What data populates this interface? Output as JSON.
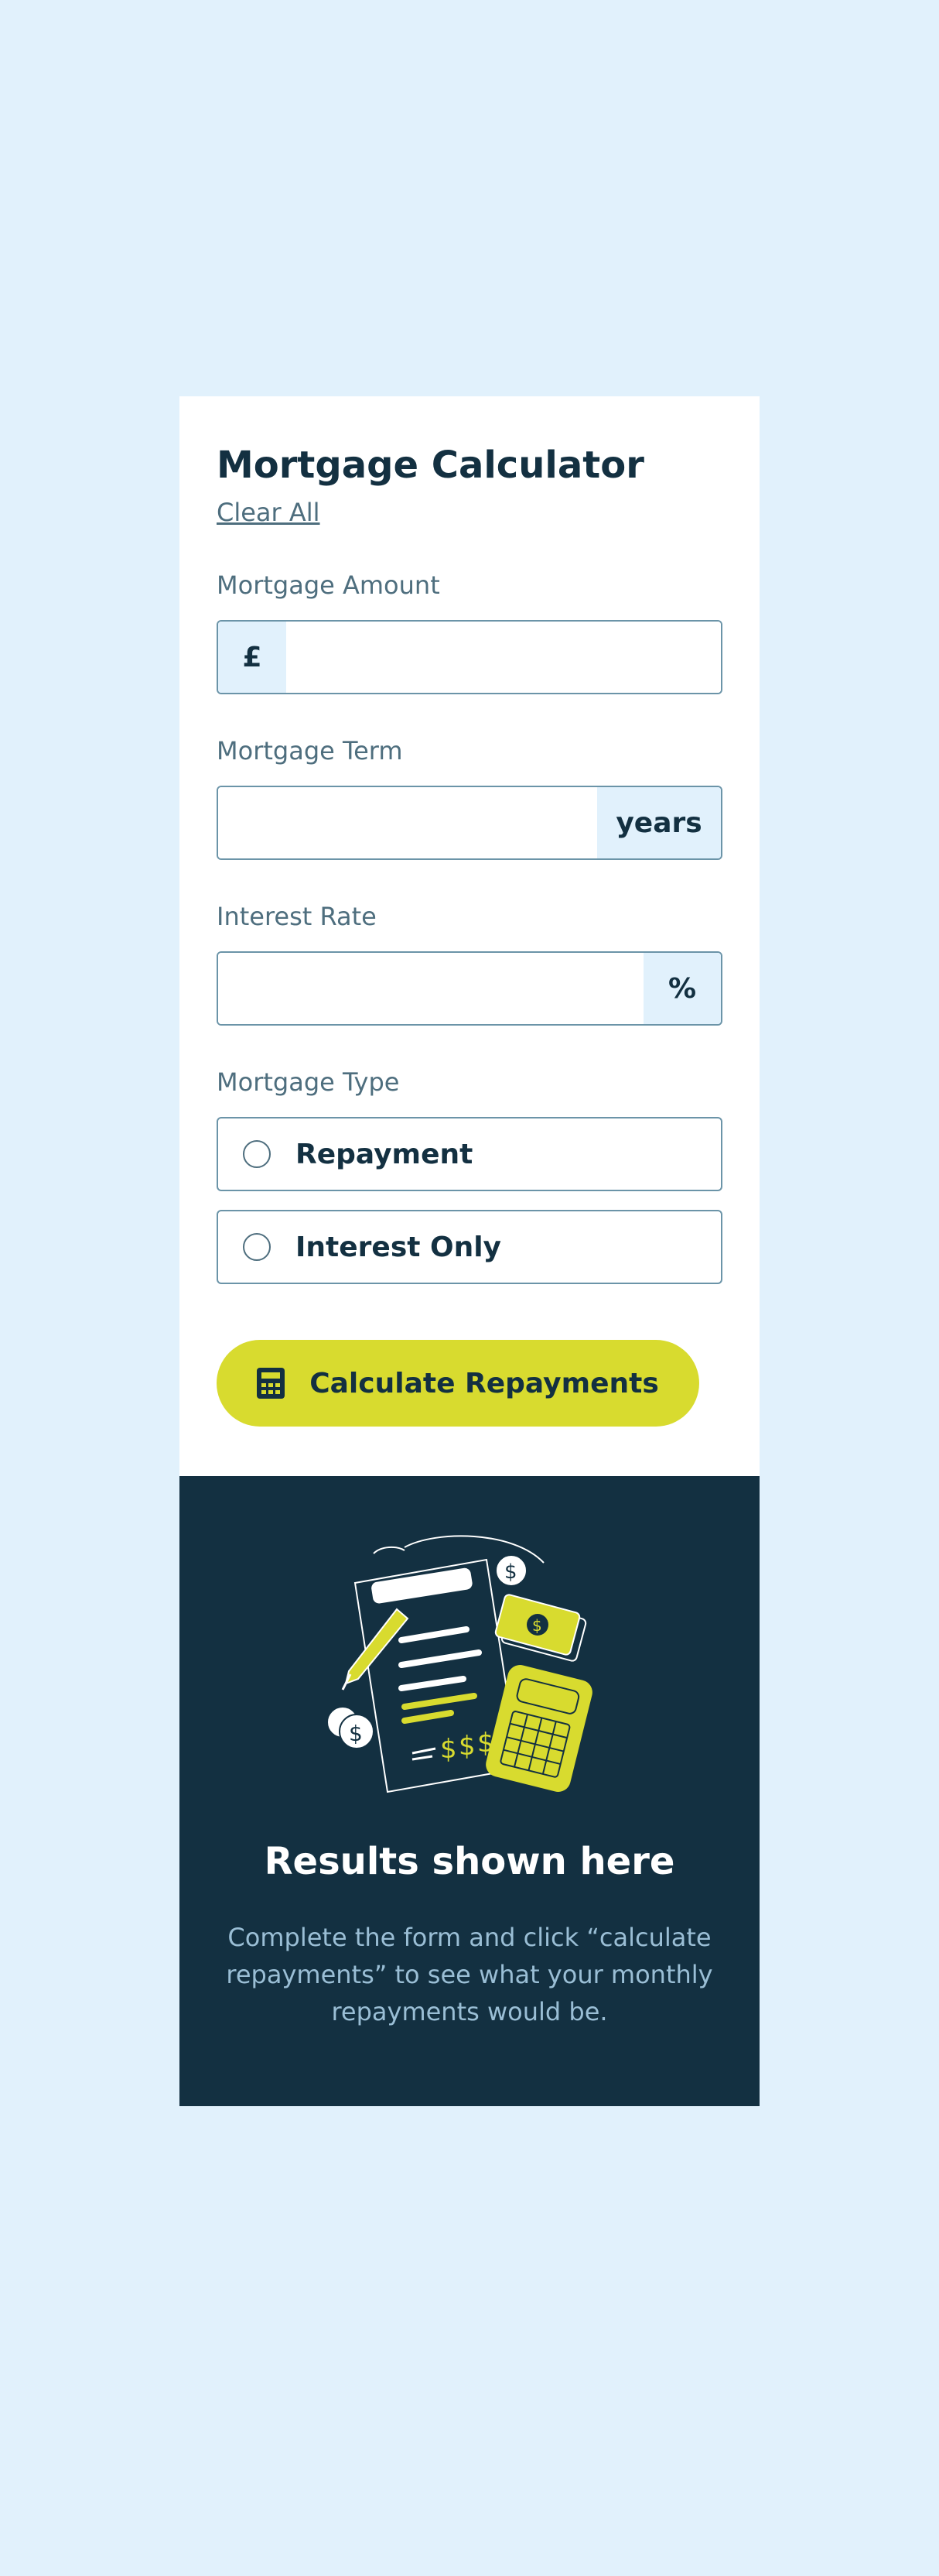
{
  "form": {
    "title": "Mortgage Calculator",
    "clear_all": "Clear All",
    "amount": {
      "label": "Mortgage Amount",
      "prefix": "£",
      "value": ""
    },
    "term": {
      "label": "Mortgage Term",
      "suffix": "years",
      "value": ""
    },
    "rate": {
      "label": "Interest Rate",
      "suffix": "%",
      "value": ""
    },
    "type": {
      "label": "Mortgage Type",
      "options": [
        "Repayment",
        "Interest Only"
      ]
    },
    "submit": {
      "label": "Calculate Repayments",
      "icon": "calculator-icon"
    }
  },
  "results": {
    "illustration_icon": "results-illustration",
    "title": "Results shown here",
    "description": "Complete the form and click “calculate repayments” to see what your monthly repayments would be."
  },
  "colors": {
    "page_background": "#e1f1fc",
    "primary": "#133041",
    "accent": "#d8db2f",
    "muted": "#4e6e7e",
    "border": "#6b94a8",
    "results_text": "#9abed5"
  }
}
